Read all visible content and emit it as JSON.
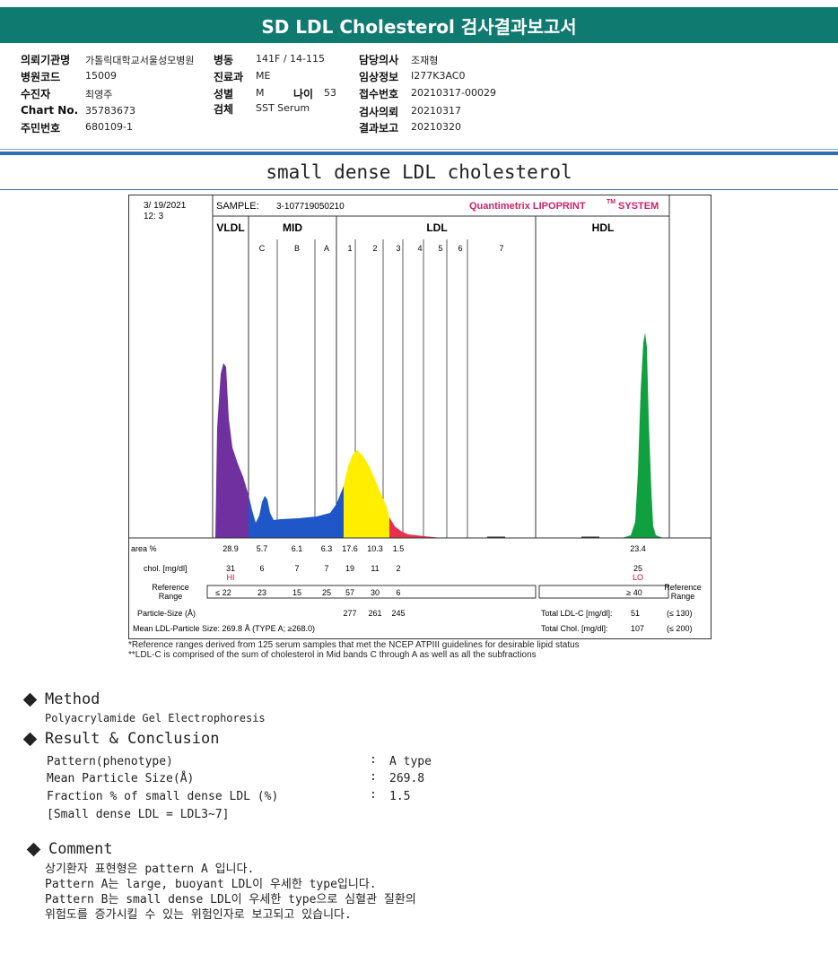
{
  "report_title": "SD LDL Cholesterol 검사결과보고서",
  "patient": {
    "institution_label": "의뢰기관명",
    "institution_value": "가톨릭대학교서울성모병원",
    "ward_label": "병동",
    "ward_value": "141F / 14-115",
    "doctor_label": "담당의사",
    "doctor_value": "조재형",
    "hospital_code_label": "병원코드",
    "hospital_code_value": "15009",
    "dept_label": "진료과",
    "dept_value": "ME",
    "clinical_label": "임상정보",
    "clinical_value": "I277K3AC0",
    "name_label": "수진자",
    "name_value": "최영주",
    "sex_label": "성별",
    "sex_value": "M",
    "age_label": "나이",
    "age_value": "53",
    "receipt_label": "접수번호",
    "receipt_value": "20210317-00029",
    "chart_label": "Chart No.",
    "chart_value": "35783673",
    "specimen_label": "검체",
    "specimen_value": "SST Serum",
    "request_label": "검사의뢰",
    "request_value": "20210317",
    "id_label": "주민번호",
    "id_value": "680109-1",
    "report_label": "결과보고",
    "report_value": "20210320"
  },
  "section_title": "small dense LDL cholesterol",
  "chart_data": {
    "type": "area",
    "date": "3/ 19/2021",
    "time": "12: 3",
    "sample_label": "SAMPLE:",
    "sample_value": "3-107719050210",
    "brand_main": "Quantimetrix LIPOPRINT",
    "brand_sup": "TM",
    "brand_tail": "SYSTEM",
    "groups": [
      {
        "name": "VLDL",
        "color": "#7030a0"
      },
      {
        "name": "MID",
        "color": "#1f57c8"
      },
      {
        "name": "LDL",
        "color": "#ffee00"
      },
      {
        "name": "HDL",
        "color": "#10a040"
      }
    ],
    "bands": [
      {
        "label": "C",
        "area": "5.7",
        "chol": "6",
        "ref": "23"
      },
      {
        "label": "B",
        "area": "6.1",
        "chol": "7",
        "ref": "15"
      },
      {
        "label": "A",
        "area": "6.3",
        "chol": "7",
        "ref": "25"
      },
      {
        "label": "1",
        "area": "17.6",
        "chol": "19",
        "ref": "57"
      },
      {
        "label": "2",
        "area": "10.3",
        "chol": "11",
        "ref": "30"
      },
      {
        "label": "3",
        "area": "1.5",
        "chol": "2",
        "ref": "6"
      },
      {
        "label": "4"
      },
      {
        "label": "5"
      },
      {
        "label": "6"
      },
      {
        "label": "7"
      }
    ],
    "vldl": {
      "area": "28.9",
      "chol": "31",
      "flag": "HI",
      "ref": "≤ 22"
    },
    "hdl": {
      "area": "23.4",
      "chol": "25",
      "flag": "LO",
      "ref": "≥ 40"
    },
    "row_labels": {
      "area": "area %",
      "chol": "chol. [mg/dl]",
      "ref": [
        "Reference",
        "Range"
      ],
      "particle": "Particle-Size (Å)",
      "mean": "Mean LDL-Particle Size:   269.8 Å   (TYPE A; ≥268.0)"
    },
    "particle_sizes": [
      "277",
      "261",
      "245"
    ],
    "total_ldl_label": "Total LDL-C [mg/dl]:",
    "total_ldl_value": "51",
    "total_ldl_ref": "(≤ 130)",
    "total_chol_label": "Total Chol. [mg/dl]:",
    "total_chol_value": "107",
    "total_chol_ref": "(≤ 200)",
    "ref_side": [
      "Reference",
      "Range"
    ]
  },
  "footnotes": [
    "*Reference ranges derived from 125 serum samples that met the NCEP ATPIII guidelines for desirable lipid status",
    "**LDL-C is comprised of the sum of cholesterol in Mid bands C through A as well as all the subfractions"
  ],
  "method": {
    "heading": "Method",
    "text": "Polyacrylamide Gel Electrophoresis"
  },
  "result": {
    "heading": "Result & Conclusion",
    "rows": [
      {
        "key": "Pattern(phenotype)",
        "value": "A type"
      },
      {
        "key": "Mean Particle Size(Å)",
        "value": "269.8"
      },
      {
        "key": "Fraction % of small dense LDL (%)",
        "value": "1.5"
      }
    ],
    "note": "[Small dense LDL = LDL3~7]"
  },
  "comment": {
    "heading": "Comment",
    "lines": [
      "상기환자 표현형은 pattern A 입니다.",
      "Pattern A는 large, buoyant LDL이 우세한 type입니다.",
      "Pattern B는 small dense LDL이 우세한 type으로 심혈관 질환의",
      "위험도를 증가시킬 수 있는 위험인자로 보고되고 있습니다."
    ]
  }
}
